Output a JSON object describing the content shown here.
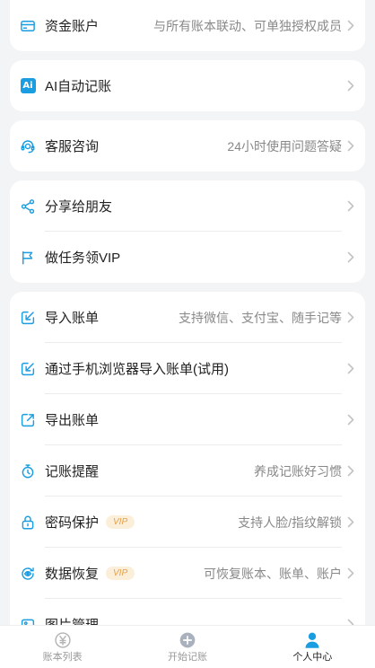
{
  "colors": {
    "accent": "#1a9de1",
    "background": "#f3f4f6",
    "badge_bg": "#fcefd9",
    "badge_text": "#e3a14d",
    "nav_icon": "#a9b2bc"
  },
  "cards": [
    {
      "rows": [
        {
          "icon": "wallet-card-icon",
          "label": "资金账户",
          "desc": "与所有账本联动、可单独授权成员"
        }
      ]
    },
    {
      "rows": [
        {
          "icon": "ai-icon",
          "icon_text": "Ai",
          "label": "AI自动记账"
        }
      ]
    },
    {
      "rows": [
        {
          "icon": "headset-icon",
          "label": "客服咨询",
          "desc": "24小时使用问题答疑"
        }
      ]
    },
    {
      "rows": [
        {
          "icon": "share-icon",
          "label": "分享给朋友"
        },
        {
          "icon": "flag-icon",
          "label": "做任务领VIP"
        }
      ]
    },
    {
      "rows": [
        {
          "icon": "import-icon",
          "label": "导入账单",
          "desc": "支持微信、支付宝、随手记等"
        },
        {
          "icon": "import-icon",
          "label": "通过手机浏览器导入账单(试用)"
        },
        {
          "icon": "export-icon",
          "label": "导出账单"
        },
        {
          "icon": "alarm-clock-icon",
          "label": "记账提醒",
          "desc": "养成记账好习惯"
        },
        {
          "icon": "lock-icon",
          "label": "密码保护",
          "badge": "VIP",
          "desc": "支持人脸/指纹解锁"
        },
        {
          "icon": "data-recovery-icon",
          "label": "数据恢复",
          "badge": "VIP",
          "desc": "可恢复账本、账单、账户"
        },
        {
          "icon": "image-icon",
          "label": "图片管理"
        }
      ]
    }
  ],
  "nav": [
    {
      "icon": "yuan-circle-icon",
      "label": "账本列表",
      "active": false
    },
    {
      "icon": "plus-circle-icon",
      "label": "开始记账",
      "active": false
    },
    {
      "icon": "person-icon",
      "label": "个人中心",
      "active": true
    }
  ]
}
